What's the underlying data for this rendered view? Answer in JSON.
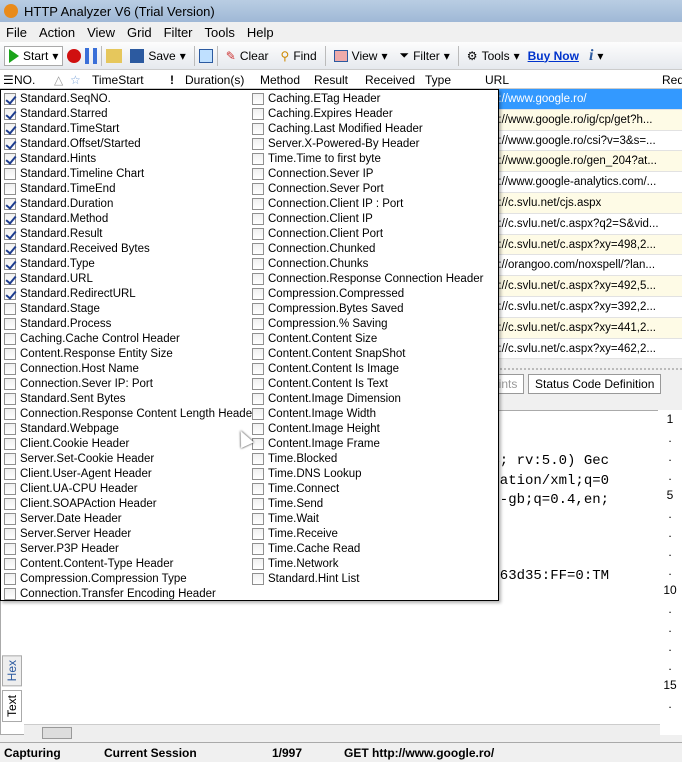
{
  "window": {
    "title": "HTTP Analyzer V6  (Trial Version)"
  },
  "menu": [
    "File",
    "Action",
    "View",
    "Grid",
    "Filter",
    "Tools",
    "Help"
  ],
  "toolbar": {
    "start": "Start",
    "save": "Save",
    "clear": "Clear",
    "find": "Find",
    "view": "View",
    "filter": "Filter",
    "tools": "Tools",
    "buy_now": "Buy Now"
  },
  "grid": {
    "columns": [
      "NO.",
      "TimeStart",
      "Duration(s)",
      "Method",
      "Result",
      "Received",
      "Type",
      "URL",
      "Red"
    ],
    "urls": [
      "p://www.google.ro/",
      "p://www.google.ro/ig/cp/get?h...",
      "p://www.google.ro/csi?v=3&s=...",
      "p://www.google.ro/gen_204?at...",
      "p://www.google-analytics.com/...",
      "p://c.svlu.net/cjs.aspx",
      "p://c.svlu.net/c.aspx?q2=S&vid...",
      "p://c.svlu.net/c.aspx?xy=498,2...",
      "p://orangoo.com/noxspell/?lan...",
      "p://c.svlu.net/c.aspx?xy=492,5...",
      "p://c.svlu.net/c.aspx?xy=392,2...",
      "p://c.svlu.net/c.aspx?xy=441,2...",
      "p://c.svlu.net/c.aspx?xy=462,2..."
    ]
  },
  "tabs": {
    "partial": "lints",
    "status_code": "Status Code Definition"
  },
  "editor": {
    "lines": [
      "64; rv:5.0) Gec",
      "ication/xml;q=0",
      "en-gb;q=0.4,en;",
      "eb63d35:FF=0:TM"
    ],
    "line_numbers": [
      "1",
      ".",
      ".",
      ".",
      "5",
      ".",
      ".",
      ".",
      ".",
      "10",
      ".",
      ".",
      ".",
      ".",
      "15",
      "."
    ],
    "left_tabs": [
      "Hex",
      "Text"
    ]
  },
  "column_chooser": {
    "left": [
      {
        "label": "Standard.SeqNO.",
        "checked": true
      },
      {
        "label": "Standard.Starred",
        "checked": true
      },
      {
        "label": "Standard.TimeStart",
        "checked": true
      },
      {
        "label": "Standard.Offset/Started",
        "checked": true
      },
      {
        "label": "Standard.Hints",
        "checked": true
      },
      {
        "label": "Standard.Timeline Chart",
        "checked": false
      },
      {
        "label": "Standard.TimeEnd",
        "checked": false
      },
      {
        "label": "Standard.Duration",
        "checked": true
      },
      {
        "label": "Standard.Method",
        "checked": true
      },
      {
        "label": "Standard.Result",
        "checked": true
      },
      {
        "label": "Standard.Received Bytes",
        "checked": true
      },
      {
        "label": "Standard.Type",
        "checked": true
      },
      {
        "label": "Standard.URL",
        "checked": true
      },
      {
        "label": "Standard.RedirectURL",
        "checked": true
      },
      {
        "label": "Standard.Stage",
        "checked": false
      },
      {
        "label": "Standard.Process",
        "checked": false
      },
      {
        "label": "Caching.Cache Control Header",
        "checked": false
      },
      {
        "label": "Content.Response Entity Size",
        "checked": false
      },
      {
        "label": "Connection.Host Name",
        "checked": false
      },
      {
        "label": "Connection.Sever IP: Port",
        "checked": false
      },
      {
        "label": "Standard.Sent Bytes",
        "checked": false
      },
      {
        "label": "Connection.Response Content Length Header",
        "checked": false
      },
      {
        "label": "Standard.Webpage",
        "checked": false
      },
      {
        "label": "Client.Cookie Header",
        "checked": false
      },
      {
        "label": "Server.Set-Cookie Header",
        "checked": false
      },
      {
        "label": "Client.User-Agent Header",
        "checked": false
      },
      {
        "label": "Client.UA-CPU Header",
        "checked": false
      },
      {
        "label": "Client.SOAPAction Header",
        "checked": false
      },
      {
        "label": "Server.Date Header",
        "checked": false
      },
      {
        "label": "Server.Server Header",
        "checked": false
      },
      {
        "label": "Server.P3P Header",
        "checked": false
      },
      {
        "label": "Content.Content-Type Header",
        "checked": false
      },
      {
        "label": "Compression.Compression Type",
        "checked": false
      },
      {
        "label": "Connection.Transfer Encoding Header",
        "checked": false
      }
    ],
    "right": [
      {
        "label": "Caching.ETag Header",
        "checked": false
      },
      {
        "label": "Caching.Expires Header",
        "checked": false
      },
      {
        "label": "Caching.Last Modified Header",
        "checked": false
      },
      {
        "label": "Server.X-Powered-By Header",
        "checked": false
      },
      {
        "label": "Time.Time to first byte",
        "checked": false
      },
      {
        "label": "Connection.Sever IP",
        "checked": false
      },
      {
        "label": "Connection.Sever Port",
        "checked": false
      },
      {
        "label": "Connection.Client IP : Port",
        "checked": false
      },
      {
        "label": "Connection.Client IP",
        "checked": false
      },
      {
        "label": "Connection.Client Port",
        "checked": false
      },
      {
        "label": "Connection.Chunked",
        "checked": false
      },
      {
        "label": "Connection.Chunks",
        "checked": false
      },
      {
        "label": "Connection.Response Connection Header",
        "checked": false
      },
      {
        "label": "Compression.Compressed",
        "checked": false
      },
      {
        "label": "Compression.Bytes Saved",
        "checked": false
      },
      {
        "label": "Compression.% Saving",
        "checked": false
      },
      {
        "label": "Content.Content Size",
        "checked": false
      },
      {
        "label": "Content.Content SnapShot",
        "checked": false
      },
      {
        "label": "Content.Content Is Image",
        "checked": false
      },
      {
        "label": "Content.Content Is Text",
        "checked": false
      },
      {
        "label": "Content.Image Dimension",
        "checked": false
      },
      {
        "label": "Content.Image Width",
        "checked": false
      },
      {
        "label": "Content.Image Height",
        "checked": false
      },
      {
        "label": "Content.Image Frame",
        "checked": false
      },
      {
        "label": "Time.Blocked",
        "checked": false
      },
      {
        "label": "Time.DNS Lookup",
        "checked": false
      },
      {
        "label": "Time.Connect",
        "checked": false
      },
      {
        "label": "Time.Send",
        "checked": false
      },
      {
        "label": "Time.Wait",
        "checked": false
      },
      {
        "label": "Time.Receive",
        "checked": false
      },
      {
        "label": "Time.Cache Read",
        "checked": false
      },
      {
        "label": "Time.Network",
        "checked": false
      },
      {
        "label": "Standard.Hint List",
        "checked": false
      }
    ]
  },
  "status": {
    "state": "Capturing",
    "session": "Current Session",
    "count": "1/997",
    "request": "GET  http://www.google.ro/"
  }
}
